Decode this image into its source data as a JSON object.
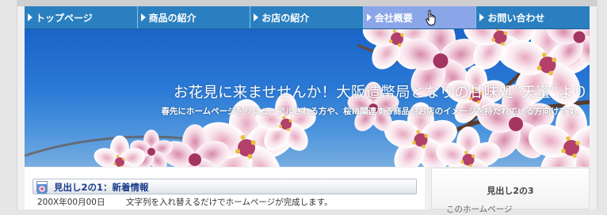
{
  "nav": {
    "items": [
      {
        "label": "トップページ"
      },
      {
        "label": "商品の紹介"
      },
      {
        "label": "お店の紹介"
      },
      {
        "label": "会社概要"
      },
      {
        "label": "お問い合わせ"
      }
    ]
  },
  "hero": {
    "title": "お花見に来ませせんか！大阪造幣局となりの甘味処”天蜜”より",
    "subtitle": "春先にホームページをリニューアルされる方や、桜に関連する商品やお店のイメージを持たれている方向けです。"
  },
  "main": {
    "heading": "見出し2の1：新着情報",
    "news": [
      {
        "date": "200X年00月00日",
        "text": "文字列を入れ替えるだけでホームページが完成します。"
      }
    ]
  },
  "sidebar": {
    "heading": "見出し2の3",
    "text": "このホームページ"
  },
  "colors": {
    "nav": "#2a7fc0",
    "nav_active": "#8aa6e8",
    "heading_text": "#1a3e8c",
    "sky": "#1a64c8"
  }
}
